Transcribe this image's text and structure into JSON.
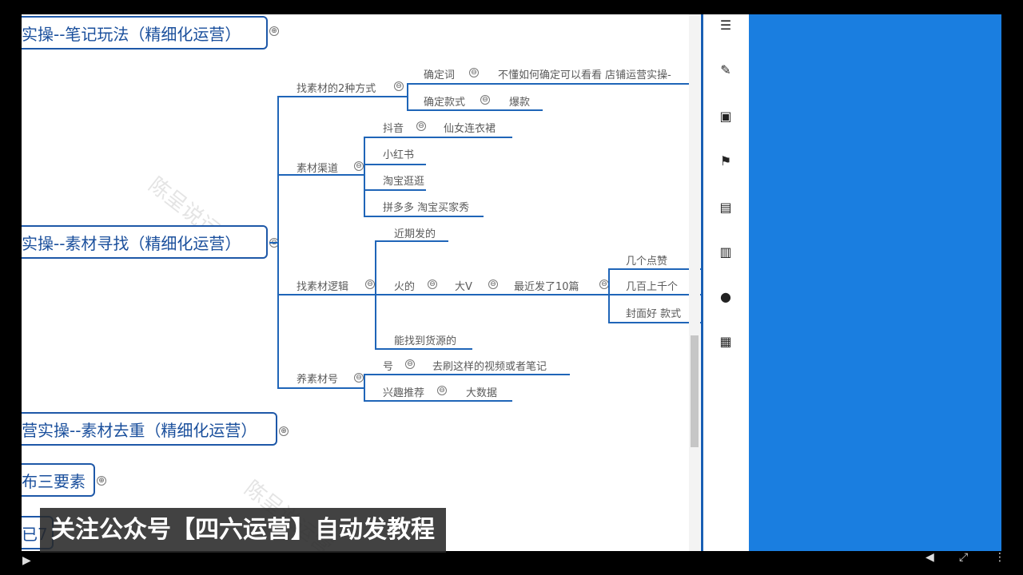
{
  "mindmap": {
    "top_nodes": {
      "node1": "实操--笔记玩法（精细化运营）",
      "node2": "实操--素材寻找（精细化运营）",
      "node3": "营实操--素材去重（精细化运营）",
      "node4": "布三要素",
      "node5": "已7"
    },
    "branch_find2": {
      "label": "找素材的2种方式",
      "c1": "确定词",
      "c1_note": "不懂如何确定可以看看 店铺运营实操-",
      "c2": "确定款式",
      "c2_note": "爆款"
    },
    "branch_channel": {
      "label": "素材渠道",
      "c1": "抖音",
      "c1_note": "仙女连衣裙",
      "c2": "小红书",
      "c3": "淘宝逛逛",
      "c4": "拼多多 淘宝买家秀"
    },
    "branch_logic": {
      "label": "找素材逻辑",
      "c1": "近期发的",
      "c2": "火的",
      "c2_a": "大V",
      "c2_b": "最近发了10篇",
      "c2_b1": "几个点赞",
      "c2_b2": "几百上千个",
      "c2_b3": "封面好  款式",
      "c3": "能找到货源的"
    },
    "branch_raise": {
      "label": "养素材号",
      "c1": "号",
      "c1_note": "去刷这样的视频或者笔记",
      "c2": "兴趣推荐",
      "c2_note": "大数据"
    }
  },
  "watermark": "陈呈说运营",
  "subtitle": "关注公众号【四六运营】自动发教程",
  "sidebar_icons": [
    "outline-icon",
    "paint-icon",
    "image-icon",
    "flag-icon",
    "keyboard-icon",
    "document-icon",
    "comment-icon",
    "clipboard-icon"
  ],
  "colors": {
    "accent": "#1e58a8",
    "panel": "#1a7ee0"
  }
}
